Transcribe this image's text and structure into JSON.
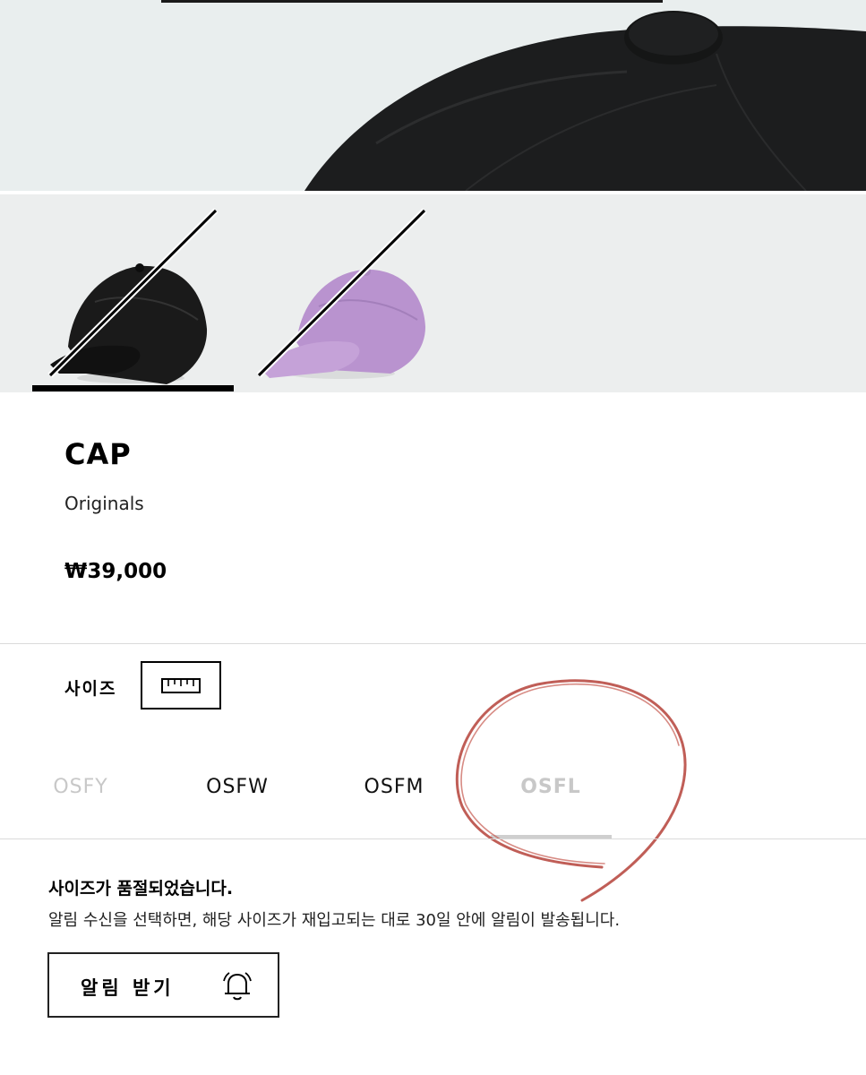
{
  "product": {
    "title": "CAP",
    "brand": "Originals",
    "price": "₩39,000"
  },
  "gallery": {
    "thumbnails": [
      {
        "color_name": "black",
        "selected": true,
        "sold_out": true
      },
      {
        "color_name": "purple",
        "selected": false,
        "sold_out": true
      }
    ]
  },
  "size": {
    "label": "사이즈",
    "guide_icon": "ruler-icon",
    "options": [
      {
        "label": "OSFY",
        "available": false
      },
      {
        "label": "OSFW",
        "available": true
      },
      {
        "label": "OSFM",
        "available": true
      },
      {
        "label": "OSFL",
        "available": false,
        "selected": true
      }
    ]
  },
  "soldout": {
    "title": "사이즈가 품절되었습니다.",
    "description": "알림 수신을 선택하면, 해당 사이즈가 재입고되는 대로 30일 안에 알림이 발송됩니다."
  },
  "notify_button": {
    "label": "알림 받기",
    "icon": "bell-icon"
  },
  "colors": {
    "annotation": "#b5423a",
    "disabled_text": "#c8c8c8"
  }
}
